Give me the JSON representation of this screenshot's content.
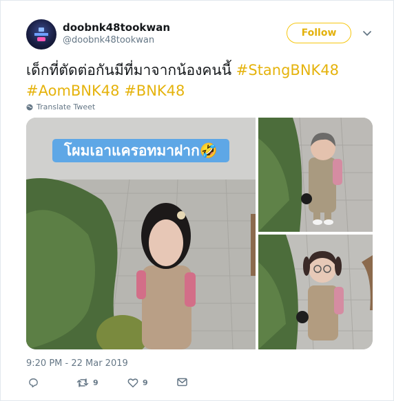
{
  "user": {
    "display_name": "doobnk48tookwan",
    "handle": "@doobnk48tookwan"
  },
  "follow_label": "Follow",
  "tweet": {
    "text": "เด็กที่ตัดต่อกันมีที่มาจากน้องคนนี้ ",
    "hashtags": [
      "#StangBNK48",
      "#AomBNK48",
      "#BNK48"
    ]
  },
  "translate_label": "Translate Tweet",
  "media": {
    "caption": "โผมเอาแครอทมาฝาก🤣"
  },
  "timestamp": "9:20 PM - 22 Mar 2019",
  "actions": {
    "retweet_count": "9",
    "like_count": "9"
  },
  "colors": {
    "accent": "#e5b30d",
    "muted": "#657786",
    "caption_bg": "#5ea7e6"
  },
  "icons": [
    "chevron-down-icon",
    "globe-icon",
    "reply-icon",
    "retweet-icon",
    "like-icon",
    "message-icon"
  ]
}
